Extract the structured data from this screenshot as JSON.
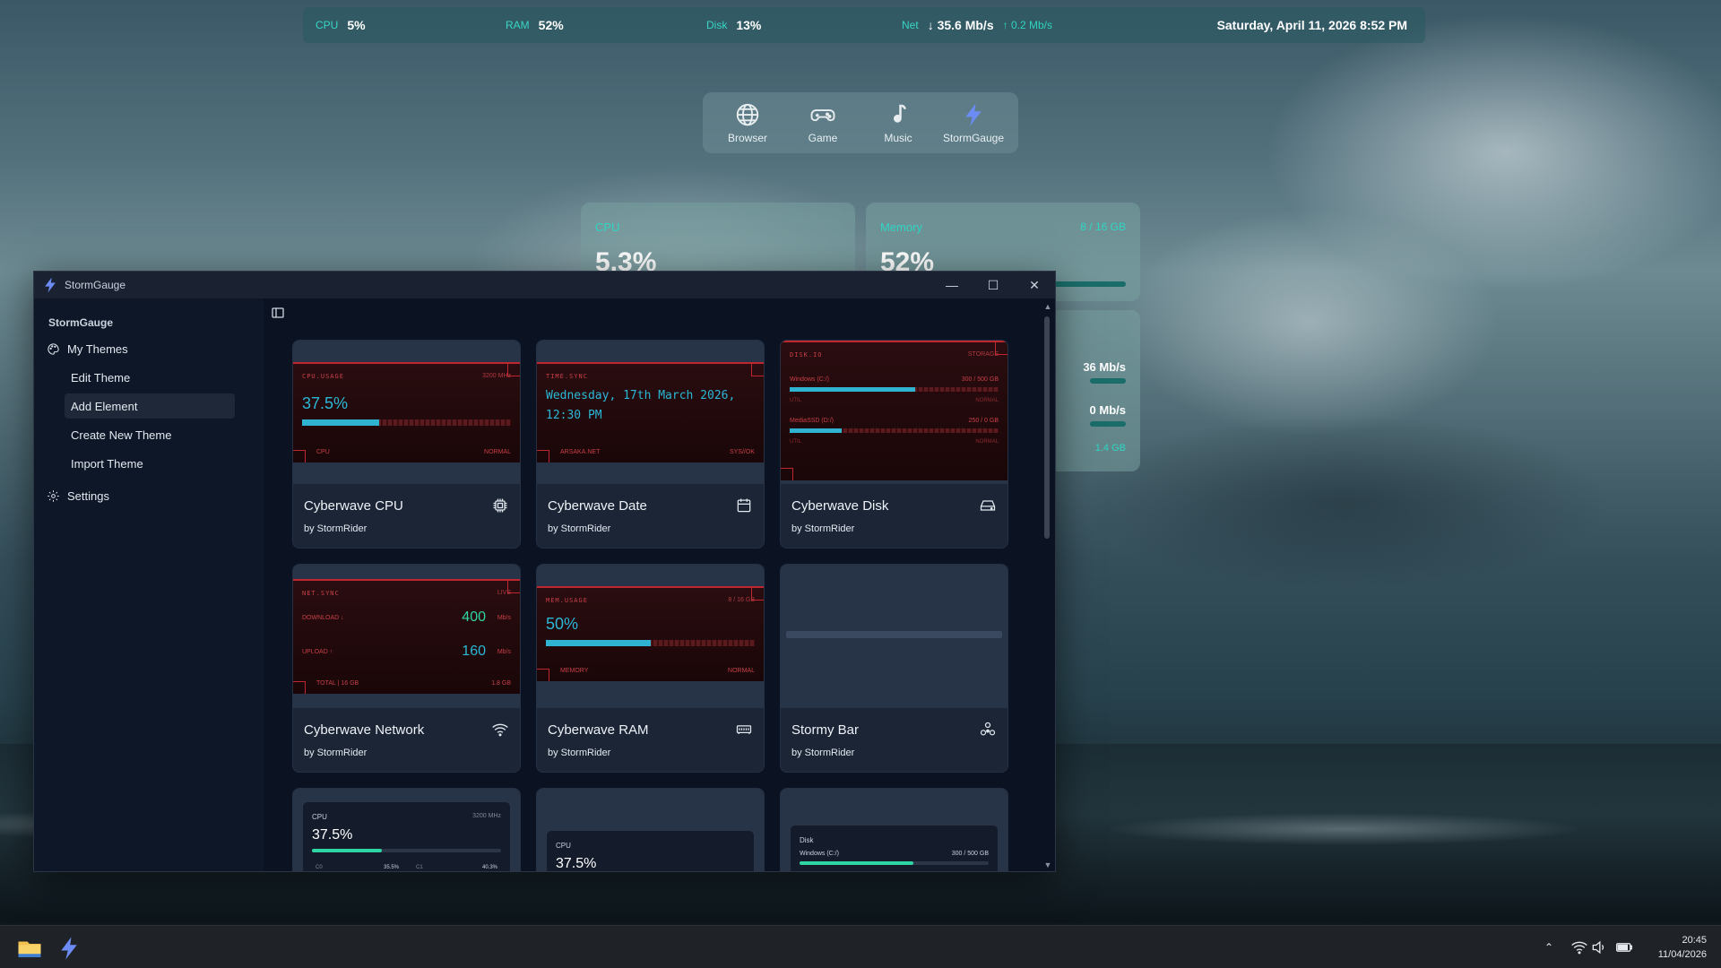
{
  "statusbar": {
    "cpu_label": "CPU",
    "cpu_value": "5%",
    "ram_label": "RAM",
    "ram_value": "52%",
    "disk_label": "Disk",
    "disk_value": "13%",
    "net_label": "Net",
    "net_down": "↓ 35.6 Mb/s",
    "net_up": "↑ 0.2 Mb/s",
    "datetime": "Saturday, April 11, 2026 8:52 PM"
  },
  "dock": [
    {
      "label": "Browser",
      "icon": "globe-icon"
    },
    {
      "label": "Game",
      "icon": "gamepad-icon"
    },
    {
      "label": "Music",
      "icon": "music-note-icon"
    },
    {
      "label": "StormGauge",
      "icon": "lightning-icon"
    }
  ],
  "desktop_widgets": {
    "cpu": {
      "title": "CPU",
      "value": "5.3%"
    },
    "memory": {
      "title": "Memory",
      "value": "52%",
      "meta": "8 / 16 GB",
      "level": 0.52
    },
    "net": {
      "down": "36 Mb/s",
      "up": "0 Mb/s",
      "total": "1.4 GB"
    }
  },
  "window": {
    "title": "StormGauge",
    "minimize": "—",
    "maximize": "☐",
    "close": "✕"
  },
  "sidebar": {
    "app_name": "StormGauge",
    "my_themes": "My Themes",
    "sub_items": [
      "Edit Theme",
      "Add Element",
      "Create New Theme",
      "Import Theme"
    ],
    "active_sub": "Add Element",
    "settings": "Settings"
  },
  "cards": [
    {
      "name": "Cyberwave CPU",
      "author": "by StormRider",
      "icon": "chip-icon"
    },
    {
      "name": "Cyberwave Date",
      "author": "by StormRider",
      "icon": "calendar-icon"
    },
    {
      "name": "Cyberwave Disk",
      "author": "by StormRider",
      "icon": "drive-icon"
    },
    {
      "name": "Cyberwave Network",
      "author": "by StormRider",
      "icon": "wifi-icon"
    },
    {
      "name": "Cyberwave RAM",
      "author": "by StormRider",
      "icon": "memory-icon"
    },
    {
      "name": "Stormy Bar",
      "author": "by StormRider",
      "icon": "network-nodes-icon"
    }
  ],
  "previews": {
    "cpu": {
      "head": "CPU.USAGE",
      "freq": "3200 MHz",
      "value": "37.5%",
      "level": 0.37,
      "foot_left": "CPU",
      "foot_right": "NORMAL"
    },
    "date": {
      "head": "TIME.SYNC",
      "date": "Wednesday, 17th March 2026,",
      "time": "12:30 PM",
      "foot_left": "ARSAKA.NET",
      "foot_right": "SYS//OK"
    },
    "disk": {
      "head": "DISK.IO",
      "tag": "STORAGE",
      "d1": "Windows (C:/)",
      "d1v": "300 / 500 GB",
      "d1level": 0.6,
      "d2": "MediaSSD (D:/)",
      "d2v": "250 / 0 GB",
      "d2level": 0.25,
      "util": "UTIL",
      "normal": "NORMAL"
    },
    "net": {
      "head": "NET.SYNC",
      "tag": "LIVE",
      "down_label": "DOWNLOAD ↓",
      "down_value": "400",
      "up_label": "UPLOAD ↑",
      "up_value": "160",
      "unit": "Mb/s",
      "foot_left": "TOTAL | 16 GB",
      "foot_right": "1.8 GB"
    },
    "ram": {
      "head": "MEM.USAGE",
      "tag": "8 / 16 GB",
      "value": "50%",
      "level": 0.5,
      "foot_left": "MEMORY",
      "foot_right": "NORMAL"
    },
    "bottom": {
      "cpu_label": "CPU",
      "cpu_freq": "3200 MHz",
      "cpu_value": "37.5%",
      "c0": "C0",
      "c0v": "35.5%",
      "c1": "C1",
      "c1v": "40.3%",
      "cpu2_label": "CPU",
      "cpu2_value": "37.5%",
      "disk_label": "Disk",
      "disk_drive": "Windows (C:/)",
      "disk_value": "300 / 500 GB"
    }
  },
  "taskbar": {
    "time": "20:45",
    "date": "11/04/2026"
  }
}
